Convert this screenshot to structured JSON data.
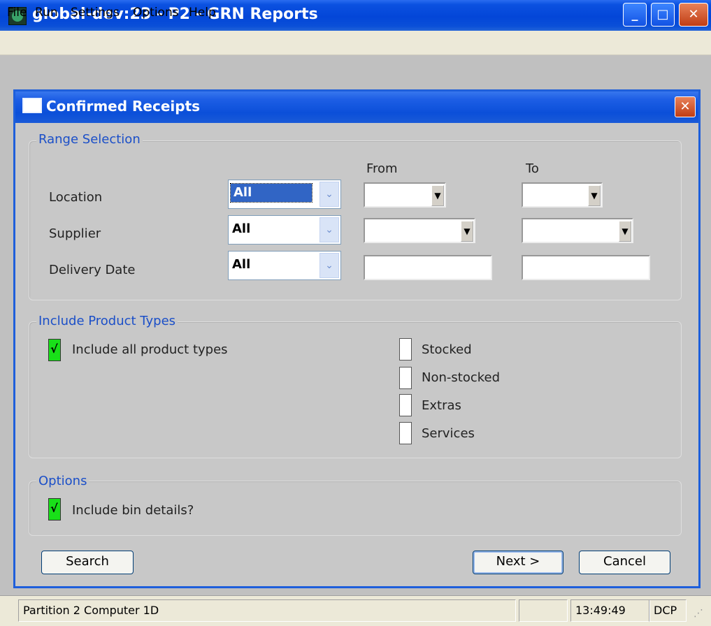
{
  "window": {
    "title": "global-dev:23 - P2 - GRN Reports",
    "minimize_symbol": "_",
    "maximize_symbol": "□",
    "close_symbol": "✕"
  },
  "menu": {
    "items": [
      {
        "label": "File",
        "mnemonic": "F"
      },
      {
        "label": "Run",
        "mnemonic": "R"
      },
      {
        "label": "Settings",
        "mnemonic": "S"
      },
      {
        "label": "Options",
        "mnemonic": "O"
      },
      {
        "label": "Help",
        "mnemonic": "H"
      }
    ]
  },
  "dialog": {
    "title": "Confirmed Receipts",
    "close_symbol": "✕",
    "range_selection": {
      "title": "Range Selection",
      "from_header": "From",
      "to_header": "To",
      "rows": [
        {
          "label": "Location",
          "mode": "All"
        },
        {
          "label": "Supplier",
          "mode": "All"
        },
        {
          "label": "Delivery Date",
          "mode": "All"
        }
      ]
    },
    "product_types": {
      "title": "Include Product Types",
      "include_all_label": "Include all product types",
      "include_all_checked": true,
      "types": [
        {
          "label": "Stocked",
          "checked": false
        },
        {
          "label": "Non-stocked",
          "checked": false
        },
        {
          "label": "Extras",
          "checked": false
        },
        {
          "label": "Services",
          "checked": false
        }
      ]
    },
    "options": {
      "title": "Options",
      "bin_details_label": "Include bin details?",
      "bin_details_checked": true
    },
    "buttons": {
      "search": "Search",
      "next": "Next >",
      "cancel": "Cancel"
    }
  },
  "status_bar": {
    "partition": "Partition 2 Computer 1D",
    "time": "13:49:49",
    "user": "DCP"
  },
  "check_glyph": "√",
  "dropdown_glyph": "▼",
  "combo_glyph": "⌄"
}
